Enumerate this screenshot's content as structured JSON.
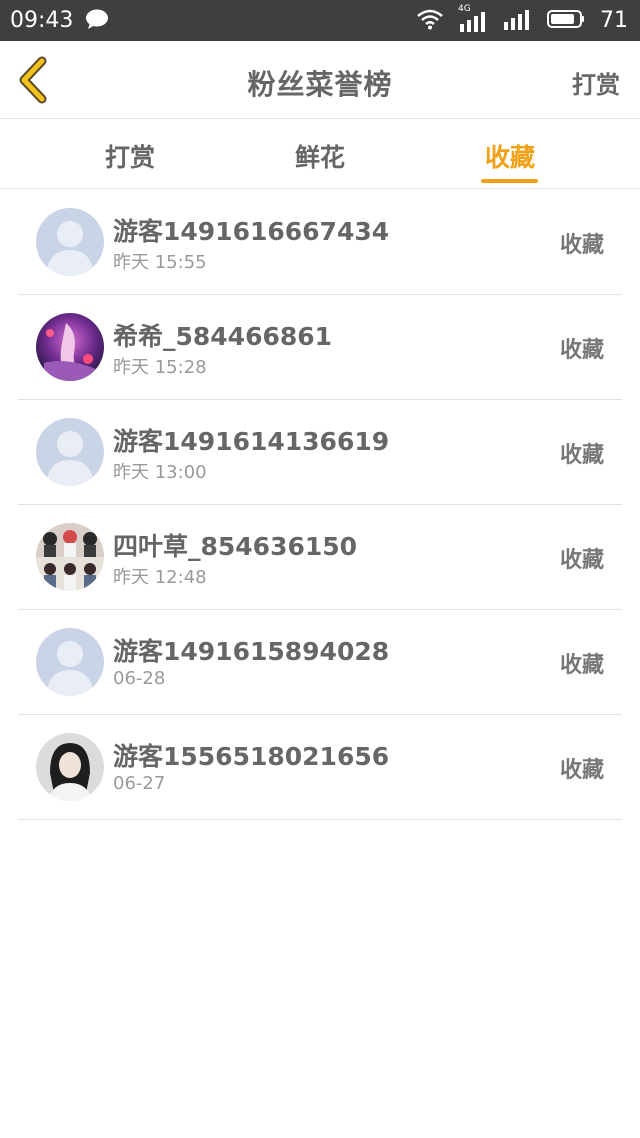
{
  "status_bar": {
    "time": "09:43",
    "network": "4G",
    "battery": "71"
  },
  "header": {
    "title": "粉丝菜誉榜",
    "action_label": "打赏",
    "back_icon": "chevron-left-icon",
    "accent_color": "#f0a117"
  },
  "tabs": [
    {
      "label": "打赏",
      "active": false
    },
    {
      "label": "鲜花",
      "active": false
    },
    {
      "label": "收藏",
      "active": true
    }
  ],
  "rows": [
    {
      "name": "游客1491616667434",
      "time": "昨天 15:55",
      "action": "收藏",
      "avatar": "default-avatar"
    },
    {
      "name": "希希_584466861",
      "time": "昨天 15:28",
      "action": "收藏",
      "avatar": "anime-avatar"
    },
    {
      "name": "游客1491614136619",
      "time": "昨天 13:00",
      "action": "收藏",
      "avatar": "default-avatar"
    },
    {
      "name": "四叶草_854636150",
      "time": "昨天 12:48",
      "action": "收藏",
      "avatar": "group-photo-avatar"
    },
    {
      "name": "游客1491615894028",
      "time": "06-28",
      "action": "收藏",
      "avatar": "default-avatar"
    },
    {
      "name": "游客1556518021656",
      "time": "06-27",
      "action": "收藏",
      "avatar": "portrait-avatar"
    }
  ]
}
